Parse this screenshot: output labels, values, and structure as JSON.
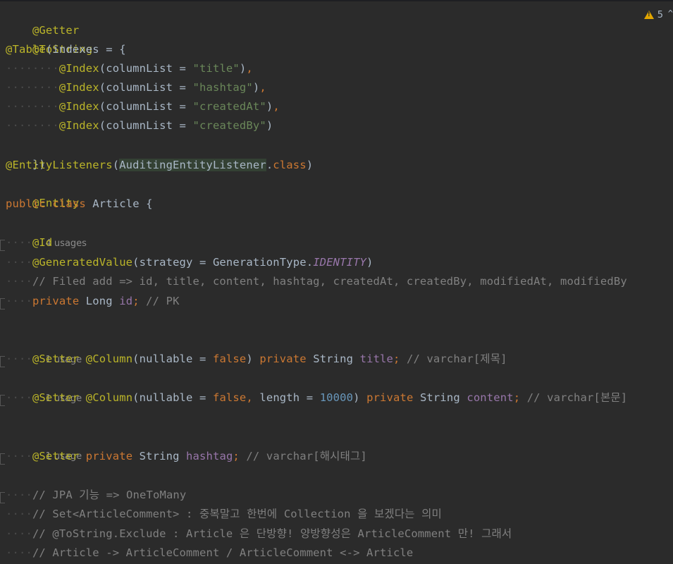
{
  "inspections": {
    "warning_count": "5"
  },
  "code": {
    "l1": "@Getter",
    "l2": "@ToString",
    "l3_ann": "@Table",
    "l3_rest": "(indexes = {",
    "idx1_ann": "@Index",
    "idx1_pre": "(columnList = ",
    "idx1_str": "\"title\"",
    "idx1_post": ")",
    "idx1_comma": ",",
    "idx2_ann": "@Index",
    "idx2_pre": "(columnList = ",
    "idx2_str": "\"hashtag\"",
    "idx2_post": ")",
    "idx2_comma": ",",
    "idx3_ann": "@Index",
    "idx3_pre": "(columnList = ",
    "idx3_str": "\"createdAt\"",
    "idx3_post": ")",
    "idx3_comma": ",",
    "idx4_ann": "@Index",
    "idx4_pre": "(columnList = ",
    "idx4_str": "\"createdBy\"",
    "idx4_post": ")",
    "l8": "})",
    "l9_ann": "@EntityListeners",
    "l9_open": "(",
    "l9_cls": "AuditingEntityListener",
    "l9_dot": ".",
    "l9_kw": "class",
    "l9_close": ")",
    "l10": "@Entity",
    "l11_kw1": "public",
    "l11_kw2": "class",
    "l11_name": "Article {",
    "usages_4": "4 usages",
    "l12": "@Id",
    "l13_ann": "@GeneratedValue",
    "l13_pre": "(strategy = GenerationType.",
    "l13_const": "IDENTITY",
    "l13_post": ")",
    "l14": "// Filed add => id, title, content, hashtag, createdAt, createdBy, modifiedAt, modifiedBy",
    "l15_kw": "private",
    "l15_type": "Long",
    "l15_fld": "id",
    "l15_semi": ";",
    "l15_cm": "// PK",
    "usage_1a": "1 usage",
    "l16_ann1": "@Setter",
    "l16_ann2": "@Column",
    "l16_pre": "(nullable = ",
    "l16_kwf": "false",
    "l16_post": ")",
    "l16_kw": "private",
    "l16_type": "String",
    "l16_fld": "title",
    "l16_semi": ";",
    "l16_cm": "// varchar[제목]",
    "usage_1b": "1 usage",
    "l17_ann1": "@Setter",
    "l17_ann2": "@Column",
    "l17_pre": "(nullable = ",
    "l17_kwf": "false",
    "l17_comma": ",",
    "l17_mid": "length = ",
    "l17_num": "10000",
    "l17_post": ")",
    "l17_kw": "private",
    "l17_type": "String",
    "l17_fld": "content",
    "l17_semi": ";",
    "l17_cm": "// varchar[본문]",
    "usage_1c": "1 usage",
    "l18_ann": "@Setter",
    "l18_kw": "private",
    "l18_type": "String",
    "l18_fld": "hashtag",
    "l18_semi": ";",
    "l18_cm": "// varchar[해시태그]",
    "l19": "// JPA 기능 => OneToMany",
    "l20": "// Set<ArticleComment> : 중복말고 한번에 Collection 을 보겠다는 의미",
    "l21": "// @ToString.Exclude : Article 은 단방향! 양방향성은 ArticleComment 만! 그래서",
    "l22": "// Article -> ArticleComment / ArticleComment <-> Article"
  }
}
